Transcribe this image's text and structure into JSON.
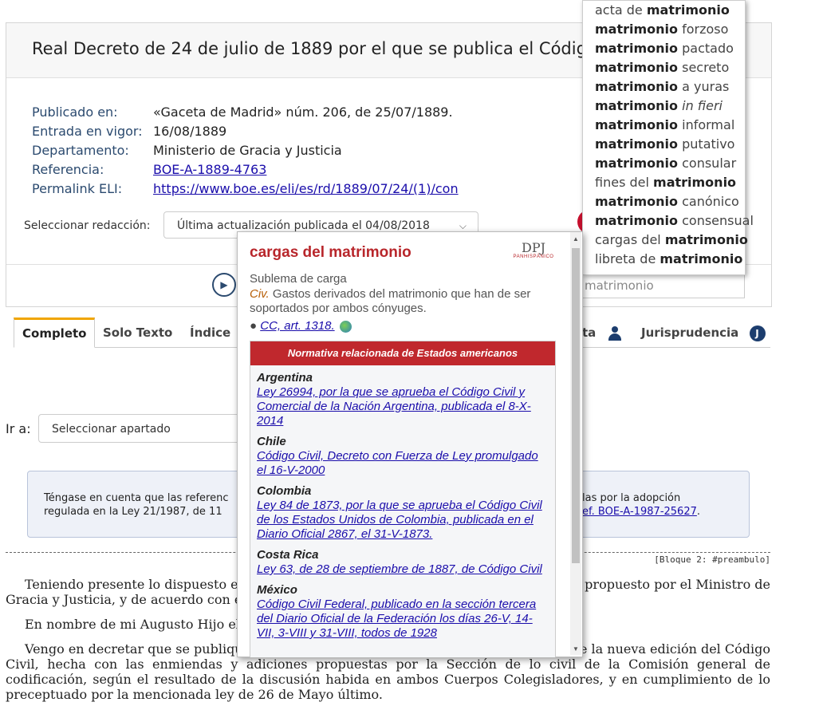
{
  "document": {
    "title": "Real Decreto de 24 de julio de 1889 por el que se publica el Código Civil.",
    "meta": [
      {
        "label": "Publicado en:",
        "value": "«Gaceta de Madrid» núm. 206, de 25/07/1889."
      },
      {
        "label": "Entrada en vigor:",
        "value": "16/08/1889"
      },
      {
        "label": "Departamento:",
        "value": "Ministerio de Gracia y Justicia"
      },
      {
        "label": "Referencia:",
        "value": "BOE-A-1889-4763"
      },
      {
        "label": "Permalink ELI:",
        "value": "https://www.boe.es/eli/es/rd/1889/07/24/(1)/con"
      }
    ],
    "select_label": "Seleccionar redacción:",
    "select_value": "Última actualización publicada el 04/08/2018",
    "search_value": "matrimonio"
  },
  "tabs": [
    {
      "label": "Completo"
    },
    {
      "label": "Solo Texto"
    },
    {
      "label": "Índice"
    },
    {
      "label": "ta"
    },
    {
      "label": "Jurisprudencia"
    }
  ],
  "icons": {
    "j": "J"
  },
  "goto": {
    "label": "Ir a:",
    "value": "Seleccionar apartado"
  },
  "notice": {
    "line1": "Téngase en cuenta que las referenc",
    "line2": "regulada en la Ley 21/1987, de 11",
    "right1": "las por la adopción",
    "right2": "ef. BOE-A-1987-25627",
    "right2_end": "."
  },
  "bloque": "[Bloque 2: #preambulo]",
  "body": {
    "p1a": "Teniendo presente lo dispuesto e",
    "p1b": "propuesto por el Ministro de",
    "p1c": "Gracia y Justicia, y de acuerdo con e",
    "p2a": "En nombre de mi Augusto Hijo el",
    "p3a": "Vengo en decretar que se publiqu",
    "p3b": "e la nueva edición del Código",
    "p3c": "Civil, hecha con las enmiendas y adiciones propuestas por la Sección de lo civil de la Comisión general de codificación, según el resultado de la discusión habida en ambos Cuerpos Colegisladores, y en cumplimiento de lo preceptuado por la mencionada ley de 26 de Mayo último."
  },
  "autocomplete": [
    {
      "pre": "acta de ",
      "bold": "matrimonio",
      "post": "",
      "italic": false
    },
    {
      "pre": "",
      "bold": "matrimonio",
      "post": " forzoso",
      "italic": false
    },
    {
      "pre": "",
      "bold": "matrimonio",
      "post": " pactado",
      "italic": false
    },
    {
      "pre": "",
      "bold": "matrimonio",
      "post": " secreto",
      "italic": false
    },
    {
      "pre": "",
      "bold": "matrimonio",
      "post": " a yuras",
      "italic": false
    },
    {
      "pre": "",
      "bold": "matrimonio",
      "post": " in fieri",
      "italic": true
    },
    {
      "pre": "",
      "bold": "matrimonio",
      "post": " informal",
      "italic": false
    },
    {
      "pre": "",
      "bold": "matrimonio",
      "post": " putativo",
      "italic": false
    },
    {
      "pre": "",
      "bold": "matrimonio",
      "post": " consular",
      "italic": false
    },
    {
      "pre": "fines del ",
      "bold": "matrimonio",
      "post": "",
      "italic": false
    },
    {
      "pre": "",
      "bold": "matrimonio",
      "post": " canónico",
      "italic": false
    },
    {
      "pre": "",
      "bold": "matrimonio",
      "post": " consensual",
      "italic": false
    },
    {
      "pre": "cargas del ",
      "bold": "matrimonio",
      "post": "",
      "italic": false
    },
    {
      "pre": "libreta de ",
      "bold": "matrimonio",
      "post": "",
      "italic": false
    }
  ],
  "popup": {
    "title": "cargas del matrimonio",
    "logo_text": "DPJ",
    "logo_sub": "PANHISPÁNICO",
    "sublema": "Sublema de carga",
    "civ": "Civ.",
    "definition": " Gastos derivados del matrimonio que han de ser soportados por ambos cónyuges.",
    "ref": "CC, art. 1318.",
    "normativa_header": "Normativa relacionada de Estados americanos",
    "countries": [
      {
        "name": "Argentina",
        "law": "Ley 26994, por la que se aprueba el Código Civil y Comercial de la Nación Argentina, publicada el 8-X-2014"
      },
      {
        "name": "Chile",
        "law": "Código Civil, Decreto con Fuerza de Ley promulgado el 16-V-2000"
      },
      {
        "name": "Colombia",
        "law": "Ley 84 de 1873, por la que se aprueba el Código Civil de los Estados Unidos de Colombia, publicada en el Diario Oficial 2867, el 31-V-1873."
      },
      {
        "name": "Costa Rica",
        "law": "Ley 63, de 28 de septiembre de 1887, de Código Civil"
      },
      {
        "name": "México",
        "law": "Código Civil Federal, publicado en la sección tercera del Diario Oficial de la Federación los días 26-V, 14-VII, 3-VIII y 31-VIII, todos de 1928"
      }
    ]
  }
}
